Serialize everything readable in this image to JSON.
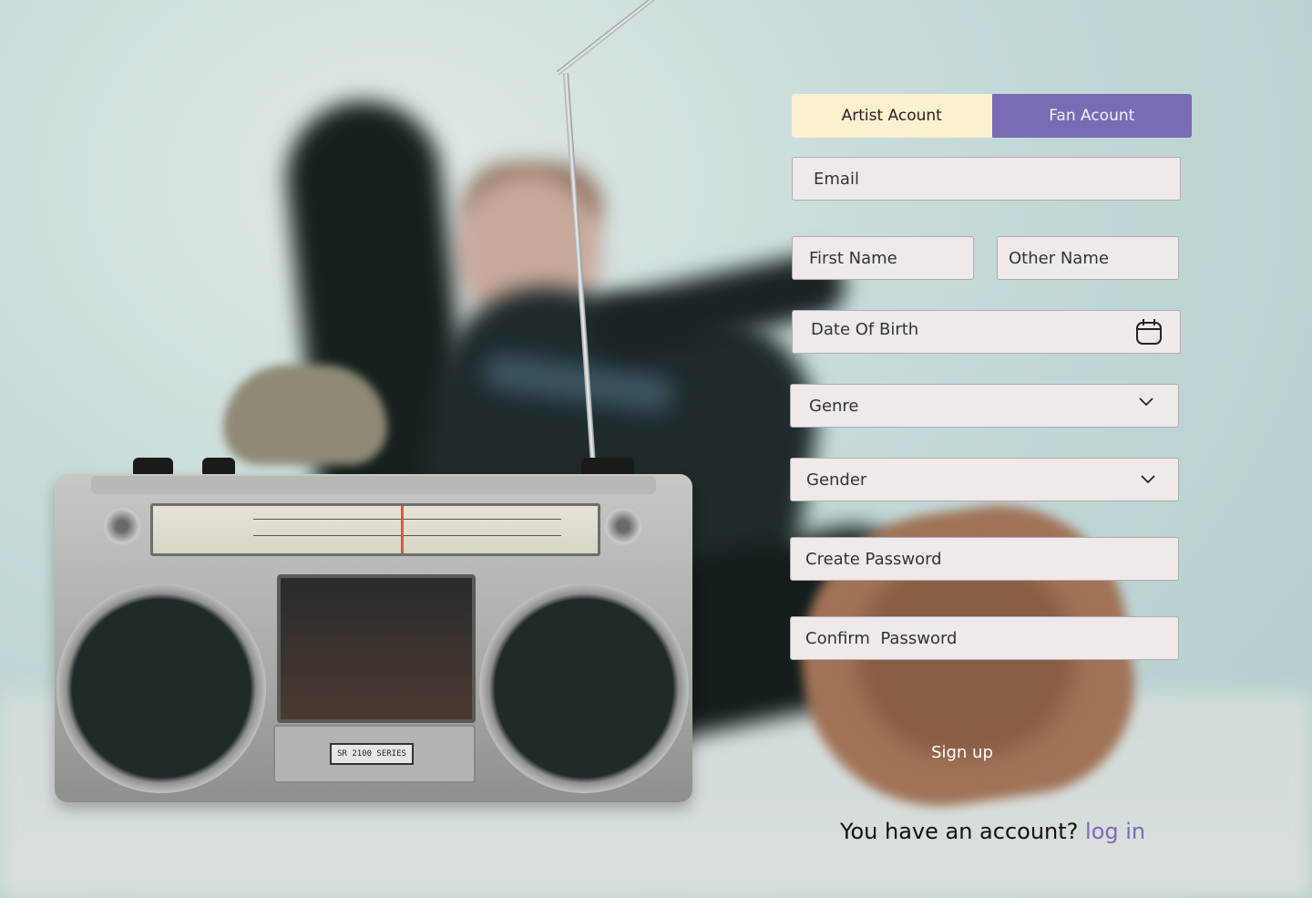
{
  "tabs": {
    "artist_label": "Artist Acount",
    "fan_label": "Fan Acount",
    "active": "fan"
  },
  "form": {
    "email_placeholder": "Email",
    "first_name_placeholder": "First Name",
    "other_name_placeholder": "Other Name",
    "dob_placeholder": "Date Of Birth",
    "genre_placeholder": "Genre",
    "gender_placeholder": "Gender",
    "create_password_placeholder": "Create Password",
    "confirm_password_placeholder": "Confirm  Password",
    "signup_label": "Sign up"
  },
  "footer": {
    "prompt": "You have an account? ",
    "login_label": "log in"
  },
  "boombox": {
    "badge": "SR 2100 SERIES"
  },
  "colors": {
    "accent": "#7b6bb4",
    "artist_tab": "#fdf0cf",
    "field_bg": "#efe9ea"
  },
  "icons": {
    "dob": "calendar-icon",
    "dropdown": "chevron-down-icon"
  }
}
